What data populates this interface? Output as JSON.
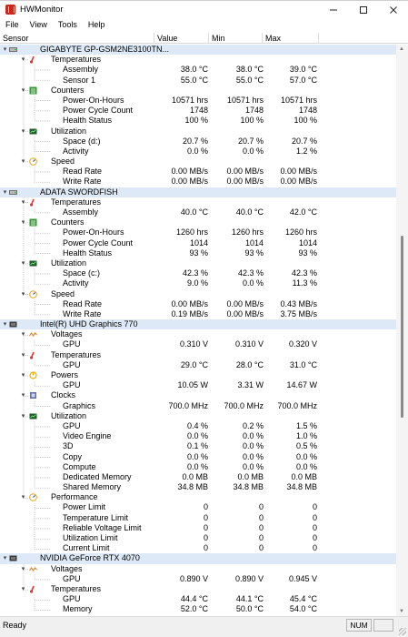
{
  "window": {
    "title": "HWMonitor",
    "controls": [
      "minimize-icon",
      "maximize-icon",
      "close-icon"
    ]
  },
  "menu": [
    "File",
    "View",
    "Tools",
    "Help"
  ],
  "columns": [
    "Sensor",
    "Value",
    "Min",
    "Max"
  ],
  "colors": {
    "device_row_bg": "#dde9f6",
    "temperature_icon": "#e03030",
    "counters_icon": "#2e9a2e",
    "utilization_icon": "#1f5a2a",
    "speed_icon": "#d9a21b",
    "voltage_icon": "#e07b1a",
    "power_icon": "#f0b000",
    "clock_icon": "#5a6fb0"
  },
  "tree": [
    {
      "level": 0,
      "type": "device",
      "label": "GIGABYTE GP-GSM2NE3100TN...",
      "icon": "drive-icon"
    },
    {
      "level": 1,
      "type": "group",
      "label": "Temperatures",
      "icon": "thermometer-icon"
    },
    {
      "level": 2,
      "label": "Assembly",
      "v": "38.0 °C",
      "min": "38.0 °C",
      "max": "39.0 °C"
    },
    {
      "level": 2,
      "label": "Sensor 1",
      "v": "55.0 °C",
      "min": "55.0 °C",
      "max": "57.0 °C"
    },
    {
      "level": 1,
      "type": "group",
      "label": "Counters",
      "icon": "counter-icon"
    },
    {
      "level": 2,
      "label": "Power-On-Hours",
      "v": "10571 hrs",
      "min": "10571 hrs",
      "max": "10571 hrs"
    },
    {
      "level": 2,
      "label": "Power Cycle Count",
      "v": "1748",
      "min": "1748",
      "max": "1748"
    },
    {
      "level": 2,
      "label": "Health Status",
      "v": "100 %",
      "min": "100 %",
      "max": "100 %"
    },
    {
      "level": 1,
      "type": "group",
      "label": "Utilization",
      "icon": "utilization-icon"
    },
    {
      "level": 2,
      "label": "Space (d:)",
      "v": "20.7 %",
      "min": "20.7 %",
      "max": "20.7 %"
    },
    {
      "level": 2,
      "label": "Activity",
      "v": "0.0 %",
      "min": "0.0 %",
      "max": "1.2 %"
    },
    {
      "level": 1,
      "type": "group",
      "label": "Speed",
      "icon": "speed-icon"
    },
    {
      "level": 2,
      "label": "Read Rate",
      "v": "0.00 MB/s",
      "min": "0.00 MB/s",
      "max": "0.00 MB/s"
    },
    {
      "level": 2,
      "label": "Write Rate",
      "v": "0.00 MB/s",
      "min": "0.00 MB/s",
      "max": "0.00 MB/s"
    },
    {
      "level": 0,
      "type": "device",
      "label": "ADATA SWORDFISH",
      "icon": "drive-icon"
    },
    {
      "level": 1,
      "type": "group",
      "label": "Temperatures",
      "icon": "thermometer-icon"
    },
    {
      "level": 2,
      "label": "Assembly",
      "v": "40.0 °C",
      "min": "40.0 °C",
      "max": "42.0 °C"
    },
    {
      "level": 1,
      "type": "group",
      "label": "Counters",
      "icon": "counter-icon"
    },
    {
      "level": 2,
      "label": "Power-On-Hours",
      "v": "1260 hrs",
      "min": "1260 hrs",
      "max": "1260 hrs"
    },
    {
      "level": 2,
      "label": "Power Cycle Count",
      "v": "1014",
      "min": "1014",
      "max": "1014"
    },
    {
      "level": 2,
      "label": "Health Status",
      "v": "93 %",
      "min": "93 %",
      "max": "93 %"
    },
    {
      "level": 1,
      "type": "group",
      "label": "Utilization",
      "icon": "utilization-icon"
    },
    {
      "level": 2,
      "label": "Space (c:)",
      "v": "42.3 %",
      "min": "42.3 %",
      "max": "42.3 %"
    },
    {
      "level": 2,
      "label": "Activity",
      "v": "9.0 %",
      "min": "0.0 %",
      "max": "11.3 %"
    },
    {
      "level": 1,
      "type": "group",
      "label": "Speed",
      "icon": "speed-icon"
    },
    {
      "level": 2,
      "label": "Read Rate",
      "v": "0.00 MB/s",
      "min": "0.00 MB/s",
      "max": "0.43 MB/s"
    },
    {
      "level": 2,
      "label": "Write Rate",
      "v": "0.19 MB/s",
      "min": "0.00 MB/s",
      "max": "3.75 MB/s"
    },
    {
      "level": 0,
      "type": "device",
      "label": "Intel(R) UHD Graphics 770",
      "icon": "gpu-icon"
    },
    {
      "level": 1,
      "type": "group",
      "label": "Voltages",
      "icon": "voltage-icon"
    },
    {
      "level": 2,
      "label": "GPU",
      "v": "0.310 V",
      "min": "0.310 V",
      "max": "0.320 V"
    },
    {
      "level": 1,
      "type": "group",
      "label": "Temperatures",
      "icon": "thermometer-icon"
    },
    {
      "level": 2,
      "label": "GPU",
      "v": "29.0 °C",
      "min": "28.0 °C",
      "max": "31.0 °C"
    },
    {
      "level": 1,
      "type": "group",
      "label": "Powers",
      "icon": "power-icon"
    },
    {
      "level": 2,
      "label": "GPU",
      "v": "10.05 W",
      "min": "3.31 W",
      "max": "14.67 W"
    },
    {
      "level": 1,
      "type": "group",
      "label": "Clocks",
      "icon": "clock-icon"
    },
    {
      "level": 2,
      "label": "Graphics",
      "v": "700.0 MHz",
      "min": "700.0 MHz",
      "max": "700.0 MHz"
    },
    {
      "level": 1,
      "type": "group",
      "label": "Utilization",
      "icon": "utilization-icon"
    },
    {
      "level": 2,
      "label": "GPU",
      "v": "0.4 %",
      "min": "0.2 %",
      "max": "1.5 %"
    },
    {
      "level": 2,
      "label": "Video Engine",
      "v": "0.0 %",
      "min": "0.0 %",
      "max": "1.0 %"
    },
    {
      "level": 2,
      "label": "3D",
      "v": "0.1 %",
      "min": "0.0 %",
      "max": "0.5 %"
    },
    {
      "level": 2,
      "label": "Copy",
      "v": "0.0 %",
      "min": "0.0 %",
      "max": "0.0 %"
    },
    {
      "level": 2,
      "label": "Compute",
      "v": "0.0 %",
      "min": "0.0 %",
      "max": "0.0 %"
    },
    {
      "level": 2,
      "label": "Dedicated Memory",
      "v": "0.0 MB",
      "min": "0.0 MB",
      "max": "0.0 MB"
    },
    {
      "level": 2,
      "label": "Shared Memory",
      "v": "34.8 MB",
      "min": "34.8 MB",
      "max": "34.8 MB"
    },
    {
      "level": 1,
      "type": "group",
      "label": "Performance",
      "icon": "speed-icon"
    },
    {
      "level": 2,
      "label": "Power Limit",
      "v": "0",
      "min": "0",
      "max": "0"
    },
    {
      "level": 2,
      "label": "Temperature Limit",
      "v": "0",
      "min": "0",
      "max": "0"
    },
    {
      "level": 2,
      "label": "Reliable Voltage Limit",
      "v": "0",
      "min": "0",
      "max": "0"
    },
    {
      "level": 2,
      "label": "Utilization Limit",
      "v": "0",
      "min": "0",
      "max": "0"
    },
    {
      "level": 2,
      "label": "Current Limit",
      "v": "0",
      "min": "0",
      "max": "0"
    },
    {
      "level": 0,
      "type": "device",
      "label": "NVIDIA GeForce RTX 4070",
      "icon": "gpu-icon"
    },
    {
      "level": 1,
      "type": "group",
      "label": "Voltages",
      "icon": "voltage-icon"
    },
    {
      "level": 2,
      "label": "GPU",
      "v": "0.890 V",
      "min": "0.890 V",
      "max": "0.945 V"
    },
    {
      "level": 1,
      "type": "group",
      "label": "Temperatures",
      "icon": "thermometer-icon"
    },
    {
      "level": 2,
      "label": "GPU",
      "v": "44.4 °C",
      "min": "44.1 °C",
      "max": "45.4 °C"
    },
    {
      "level": 2,
      "label": "Memory",
      "v": "52.0 °C",
      "min": "50.0 °C",
      "max": "54.0 °C"
    }
  ],
  "status": {
    "text": "Ready",
    "indicator": "NUM"
  }
}
